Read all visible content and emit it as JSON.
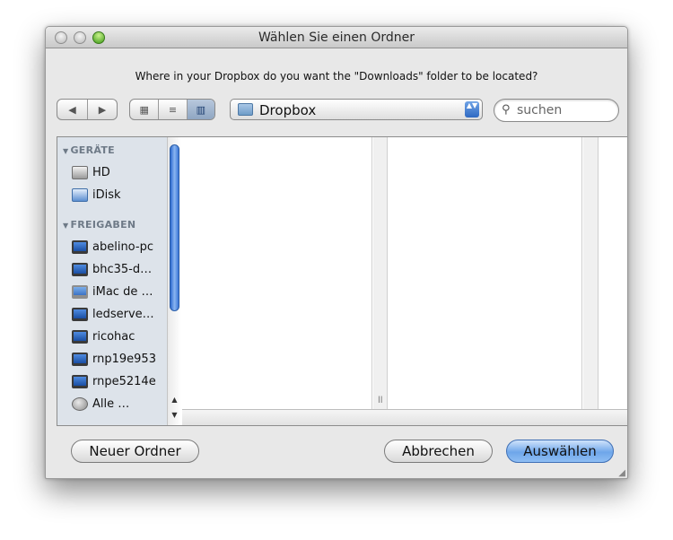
{
  "window": {
    "title": "Wählen Sie einen Ordner"
  },
  "prompt": "Where in your Dropbox do you want the \"Downloads\" folder to be located?",
  "toolbar": {
    "back_glyph": "◀",
    "forward_glyph": "▶",
    "view_icon_glyph": "▦",
    "view_list_glyph": "≡",
    "view_column_glyph": "▥",
    "location_label": "Dropbox",
    "stepper_glyph": "▲▼",
    "search_placeholder": "suchen",
    "search_glyph": "🔍"
  },
  "sidebar": {
    "groups": [
      {
        "label": "GERÄTE",
        "items": [
          {
            "label": "HD",
            "icon": "hard-disk-icon"
          },
          {
            "label": "iDisk",
            "icon": "idisk-icon"
          }
        ]
      },
      {
        "label": "FREIGABEN",
        "items": [
          {
            "label": "abelino-pc",
            "icon": "network-pc-icon"
          },
          {
            "label": "bhc35-d…",
            "icon": "network-pc-icon"
          },
          {
            "label": "iMac de …",
            "icon": "imac-icon"
          },
          {
            "label": "ledserve…",
            "icon": "network-pc-icon"
          },
          {
            "label": "ricohac",
            "icon": "network-pc-icon"
          },
          {
            "label": "rnp19e953",
            "icon": "network-pc-icon"
          },
          {
            "label": "rnpe5214e",
            "icon": "network-pc-icon"
          },
          {
            "label": "Alle …",
            "icon": "network-globe-icon"
          }
        ]
      }
    ],
    "disclosure_glyph": "▼"
  },
  "browser": {
    "column_grip_glyph": "ll"
  },
  "footer": {
    "new_folder_label": "Neuer Ordner",
    "cancel_label": "Abbrechen",
    "choose_label": "Auswählen"
  },
  "colors": {
    "accent": "#6ea6ea",
    "sidebar_bg": "#dde3ea"
  }
}
